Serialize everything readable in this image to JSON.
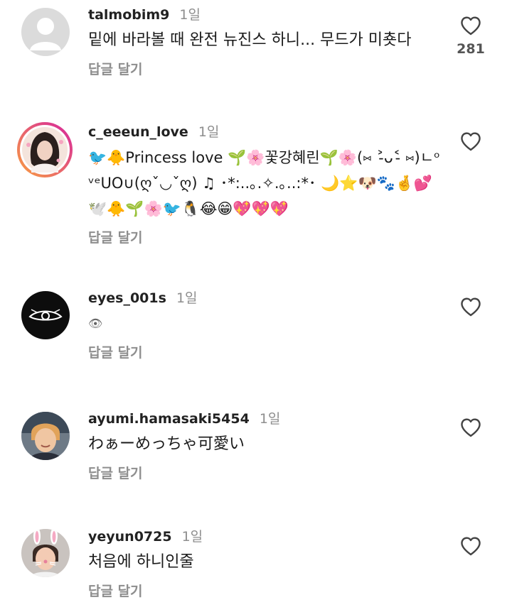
{
  "comments": [
    {
      "username": "talmobim9",
      "time": "1일",
      "text": "밑에 바라볼 때 완전 뉴진스 하니... 무드가 미춋다",
      "reply_label": "답글 달기",
      "likes": "281",
      "avatar": "default-avatar"
    },
    {
      "username": "c_eeeun_love",
      "time": "1일",
      "text": "🐦🐥Princess love 🌱🌸꽃강혜린🌱🌸(⑅ ˃̵ᴗ˂̵ ⑅)ㄴᵒᵛᵉᑌO∪(ღˇ◡ˇღ) ♫ ･*:..｡.✧.｡..:*･ 🌙⭐🐶🐾🤞💕🕊️🐥🌱🌸🐦🐧😂😁💖💖💖",
      "reply_label": "답글 달기",
      "avatar": "story-ring-avatar"
    },
    {
      "username": "eyes_001s",
      "time": "1일",
      "text": "👁",
      "reply_label": "답글 달기",
      "avatar": "eye-logo-avatar"
    },
    {
      "username": "ayumi.hamasaki5454",
      "time": "1일",
      "text": "わぁーめっちゃ可愛い",
      "reply_label": "답글 달기",
      "avatar": "photo-avatar"
    },
    {
      "username": "yeyun0725",
      "time": "1일",
      "text": "처음에 하니인줄",
      "reply_label": "답글 달기",
      "avatar": "bunny-filter-avatar"
    }
  ],
  "icons": {
    "like": "heart-outline-icon"
  },
  "colors": {
    "text_primary": "#1a1a1a",
    "text_secondary": "#8e8e8e",
    "story_ring_start": "#f9a03f",
    "story_ring_end": "#d6249f"
  }
}
